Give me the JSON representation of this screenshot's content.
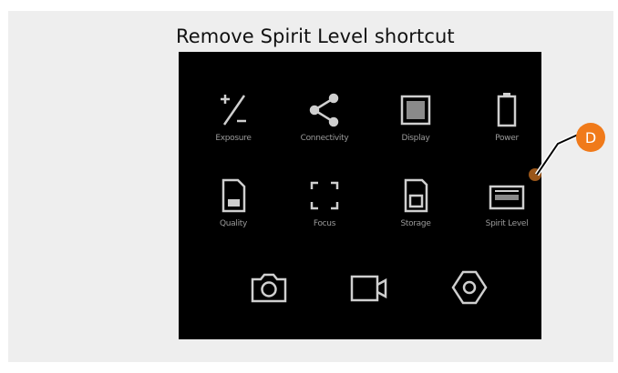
{
  "caption": "Remove Spirit Level shortcut",
  "menu": {
    "tiles": [
      {
        "label": "Exposure",
        "icon": "exposure-icon"
      },
      {
        "label": "Connectivity",
        "icon": "connectivity-icon"
      },
      {
        "label": "Display",
        "icon": "display-icon"
      },
      {
        "label": "Power",
        "icon": "battery-icon"
      },
      {
        "label": "Quality",
        "icon": "image-file-icon"
      },
      {
        "label": "Focus",
        "icon": "focus-frame-icon"
      },
      {
        "label": "Storage",
        "icon": "sd-card-icon"
      },
      {
        "label": "Spirit Level",
        "icon": "spirit-level-icon"
      }
    ],
    "bottom_bar": [
      {
        "icon": "camera-icon"
      },
      {
        "icon": "video-icon"
      },
      {
        "icon": "settings-gear-icon"
      }
    ]
  },
  "callout": {
    "label": "D",
    "color": "#f07a1a",
    "target_color": "#b5651d"
  }
}
